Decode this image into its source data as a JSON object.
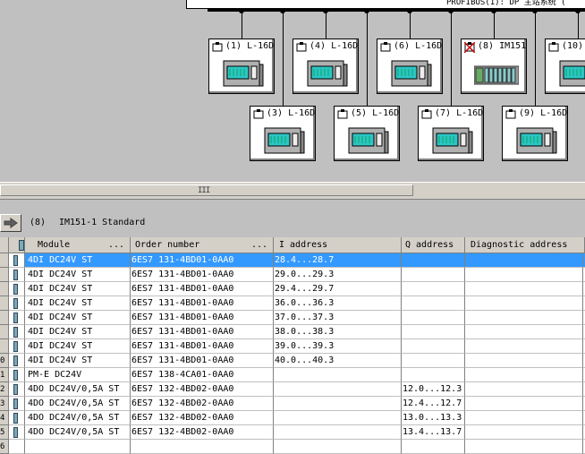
{
  "network": {
    "bus_label": "PROFIBUS(1): DP 主站系统 (",
    "stations": [
      {
        "label": "(1) L-16D",
        "type": "plc"
      },
      {
        "label": "(4) L-16D",
        "type": "plc"
      },
      {
        "label": "(6) L-16D",
        "type": "plc"
      },
      {
        "label": "(8) IM151",
        "type": "et200s"
      },
      {
        "label": "(10)",
        "type": "plc"
      },
      {
        "label": "(3) L-16D",
        "type": "plc"
      },
      {
        "label": "(5) L-16D",
        "type": "plc"
      },
      {
        "label": "(7) L-16D",
        "type": "plc"
      },
      {
        "label": "(9) L-16D",
        "type": "plc"
      }
    ]
  },
  "scrollbar": {
    "grip": "III"
  },
  "detail": {
    "slot": "(8)",
    "module": "IM151-1 Standard",
    "back_icon": "arrow-right-icon"
  },
  "table": {
    "columns": {
      "module": "Module",
      "module_dots": "...",
      "order": "Order number",
      "order_dots": "...",
      "i_address": "I address",
      "q_address": "Q address",
      "diag_address": "Diagnostic address"
    },
    "rows": [
      {
        "slot": "",
        "module": "4DI DC24V ST",
        "order": "6ES7 131-4BD01-0AA0",
        "i": "28.4...28.7",
        "q": "",
        "diag": "",
        "selected": true
      },
      {
        "slot": "",
        "module": "4DI DC24V ST",
        "order": "6ES7 131-4BD01-0AA0",
        "i": "29.0...29.3",
        "q": "",
        "diag": ""
      },
      {
        "slot": "",
        "module": "4DI DC24V ST",
        "order": "6ES7 131-4BD01-0AA0",
        "i": "29.4...29.7",
        "q": "",
        "diag": ""
      },
      {
        "slot": "",
        "module": "4DI DC24V ST",
        "order": "6ES7 131-4BD01-0AA0",
        "i": "36.0...36.3",
        "q": "",
        "diag": ""
      },
      {
        "slot": "",
        "module": "4DI DC24V ST",
        "order": "6ES7 131-4BD01-0AA0",
        "i": "37.0...37.3",
        "q": "",
        "diag": ""
      },
      {
        "slot": "",
        "module": "4DI DC24V ST",
        "order": "6ES7 131-4BD01-0AA0",
        "i": "38.0...38.3",
        "q": "",
        "diag": ""
      },
      {
        "slot": "",
        "module": "4DI DC24V ST",
        "order": "6ES7 131-4BD01-0AA0",
        "i": "39.0...39.3",
        "q": "",
        "diag": ""
      },
      {
        "slot": "0",
        "module": "4DI DC24V ST",
        "order": "6ES7 131-4BD01-0AA0",
        "i": "40.0...40.3",
        "q": "",
        "diag": ""
      },
      {
        "slot": "1",
        "module": "PM-E DC24V",
        "order": "6ES7 138-4CA01-0AA0",
        "i": "",
        "q": "",
        "diag": ""
      },
      {
        "slot": "2",
        "module": "4DO DC24V/0,5A ST",
        "order": "6ES7 132-4BD02-0AA0",
        "i": "",
        "q": "12.0...12.3",
        "diag": ""
      },
      {
        "slot": "3",
        "module": "4DO DC24V/0,5A ST",
        "order": "6ES7 132-4BD02-0AA0",
        "i": "",
        "q": "12.4...12.7",
        "diag": ""
      },
      {
        "slot": "4",
        "module": "4DO DC24V/0,5A ST",
        "order": "6ES7 132-4BD02-0AA0",
        "i": "",
        "q": "13.0...13.3",
        "diag": ""
      },
      {
        "slot": "5",
        "module": "4DO DC24V/0,5A ST",
        "order": "6ES7 132-4BD02-0AA0",
        "i": "",
        "q": "13.4...13.7",
        "diag": ""
      },
      {
        "slot": "6",
        "module": "",
        "order": "",
        "i": "",
        "q": "",
        "diag": ""
      }
    ]
  }
}
